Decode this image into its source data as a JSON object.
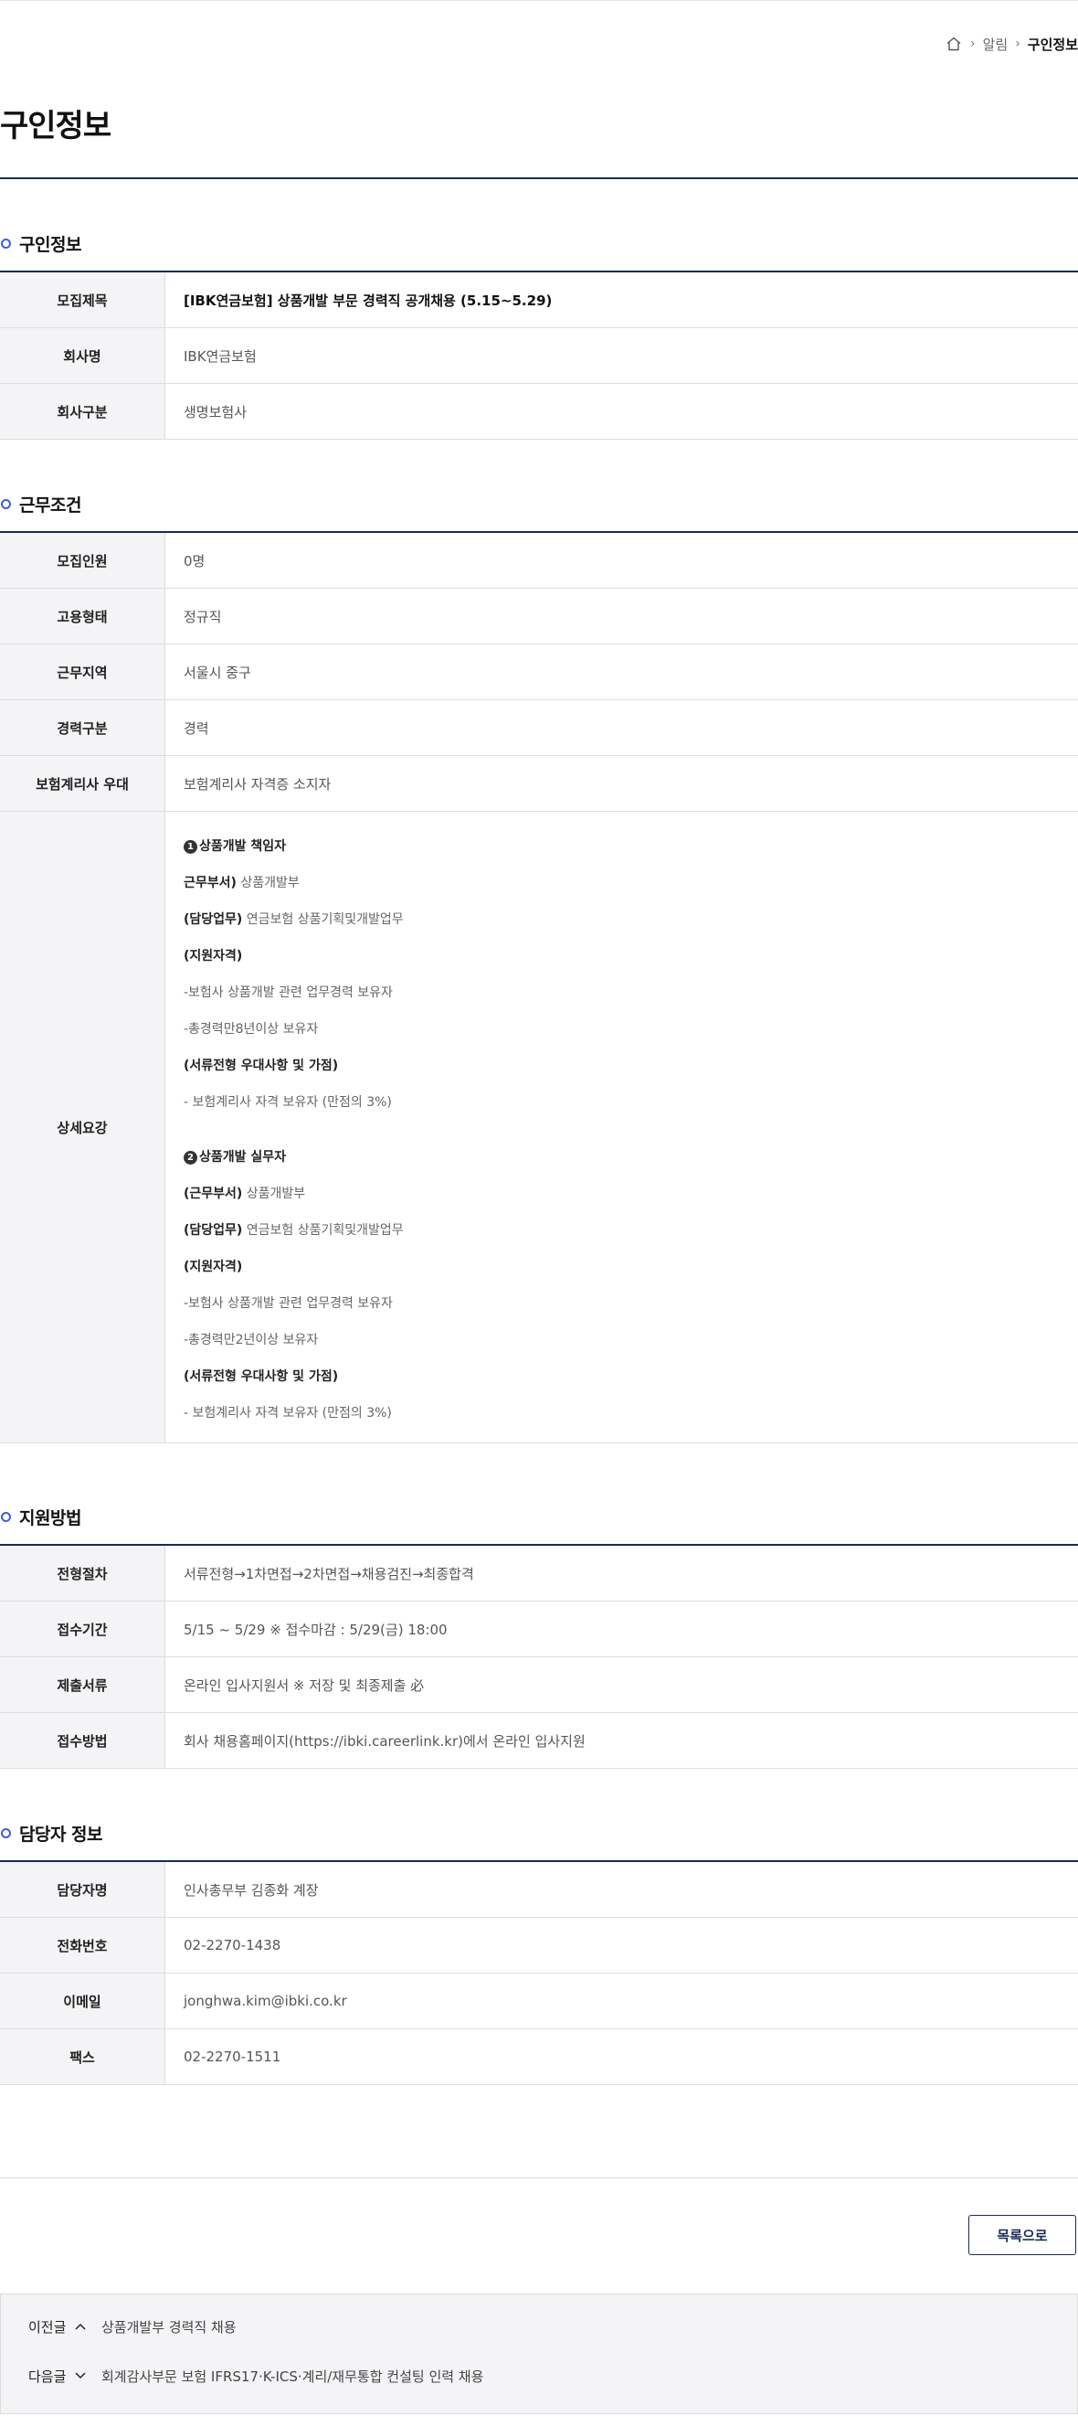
{
  "breadcrumb": {
    "items": [
      "알림",
      "구인정보"
    ]
  },
  "page": {
    "title": "구인정보"
  },
  "sections": {
    "job_info": {
      "heading": "구인정보",
      "rows": [
        {
          "label": "모집제목",
          "value": "[IBK연금보험] 상품개발 부문 경력직 공개채용 (5.15~5.29)"
        },
        {
          "label": "회사명",
          "value": "IBK연금보험"
        },
        {
          "label": "회사구분",
          "value": "생명보험사"
        }
      ]
    },
    "conditions": {
      "heading": "근무조건",
      "rows": [
        {
          "label": "모집인원",
          "value": "0명"
        },
        {
          "label": "고용형태",
          "value": "정규직"
        },
        {
          "label": "근무지역",
          "value": "서울시 중구"
        },
        {
          "label": "경력구분",
          "value": "경력"
        },
        {
          "label": "보험계리사 우대",
          "value": "보험계리사 자격증 소지자"
        }
      ],
      "detail": {
        "label": "상세요강",
        "blocks": [
          {
            "title_num": "1",
            "title": "상품개발 책임자",
            "dept_label": "근무부서)",
            "dept": " 상품개발부",
            "duty_label": "(담당업무)",
            "duty": " 연금보험 상품기획및개발업무",
            "qual_label": "(지원자격)",
            "qual1": "-보험사 상품개발 관련 업무경력 보유자",
            "qual2": "-총경력만8년이상 보유자",
            "pref_label": "(서류전형 우대사항 및 가점)",
            "pref": "- 보험계리사 자격 보유자 (만점의 3%)"
          },
          {
            "title_num": "2",
            "title": "상품개발 실무자",
            "dept_label": "(근무부서)",
            "dept": " 상품개발부",
            "duty_label": "(담당업무)",
            "duty": " 연금보험 상품기획및개발업무",
            "qual_label": "(지원자격)",
            "qual1": "-보험사 상품개발 관련 업무경력 보유자",
            "qual2": "-총경력만2년이상 보유자",
            "pref_label": "(서류전형 우대사항 및 가점)",
            "pref": "- 보험계리사 자격 보유자 (만점의 3%)"
          }
        ]
      }
    },
    "apply": {
      "heading": "지원방법",
      "rows": [
        {
          "label": "전형절차",
          "value": "서류전형→1차면접→2차면접→채용검진→최종합격"
        },
        {
          "label": "접수기간",
          "value": "5/15 ~ 5/29 ※ 접수마감 : 5/29(금) 18:00"
        },
        {
          "label": "제출서류",
          "value": "온라인 입사지원서 ※ 저장 및 최종제출 必"
        },
        {
          "label": "접수방법",
          "value": "회사 채용홈페이지(https://ibki.careerlink.kr)에서 온라인 입사지원"
        }
      ]
    },
    "contact": {
      "heading": "담당자 정보",
      "rows": [
        {
          "label": "담당자명",
          "value": "인사총무부 김종화 계장"
        },
        {
          "label": "전화번호",
          "value": "02-2270-1438"
        },
        {
          "label": "이메일",
          "value": "jonghwa.kim@ibki.co.kr"
        },
        {
          "label": "팩스",
          "value": "02-2270-1511"
        }
      ]
    }
  },
  "actions": {
    "list_button": "목록으로"
  },
  "post_nav": {
    "prev": {
      "label": "이전글",
      "title": "상품개발부 경력직 채용"
    },
    "next": {
      "label": "다음글",
      "title": "회계감사부문 보험 IFRS17·K-ICS·계리/재무통합 컨설팅 인력 채용"
    }
  },
  "colors": {
    "accent": "#1b2a55",
    "dot": "#3d5fd8",
    "header_bg": "#f4f4f7"
  },
  "icons": [
    "home-icon",
    "chevron-right-icon",
    "chevron-up-icon",
    "chevron-down-icon"
  ]
}
